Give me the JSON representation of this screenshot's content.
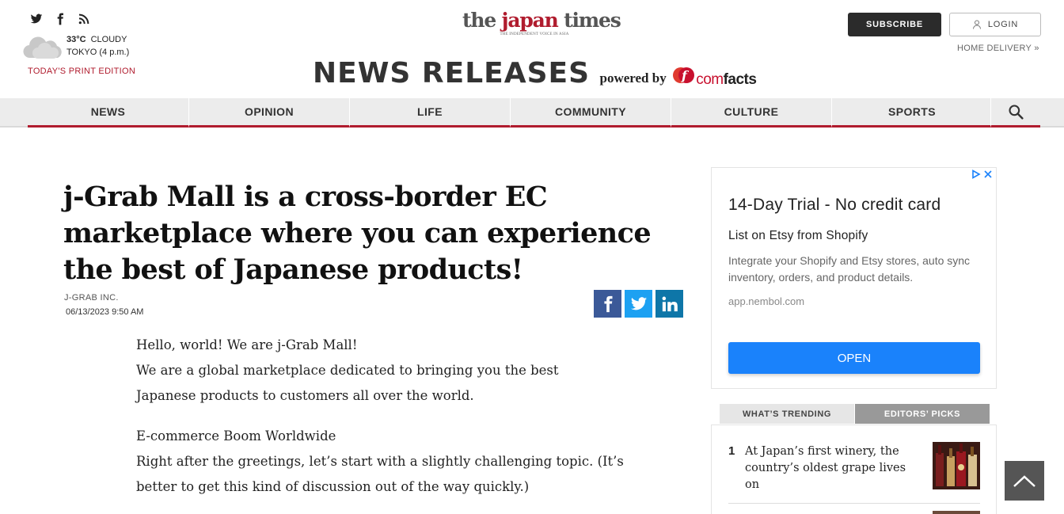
{
  "header": {
    "social_icons": [
      "twitter-icon",
      "facebook-icon",
      "rss-icon"
    ],
    "weather": {
      "temp": "33°C",
      "condition": "CLOUDY",
      "location": "TOKYO (4 p.m.)",
      "icon": "cloud-icon"
    },
    "print_edition": "TODAY'S PRINT EDITION",
    "logo": {
      "part1": "the ",
      "part2": "japan",
      "part3": " times",
      "tagline": "THE INDEPENDENT VOICE IN ASIA"
    },
    "section_title": "NEWS RELEASES",
    "powered_by": "powered by",
    "comfacts": {
      "part1": "com",
      "part2": "facts"
    },
    "subscribe": "SUBSCRIBE",
    "login": "LOGIN",
    "home_delivery": "HOME DELIVERY »"
  },
  "nav": {
    "items": [
      "NEWS",
      "OPINION",
      "LIFE",
      "COMMUNITY",
      "CULTURE",
      "SPORTS"
    ],
    "search_icon": "search-icon"
  },
  "article": {
    "headline": "j-Grab Mall is a cross-border EC marketplace where you can experience the best of Japanese products!",
    "byline": "J-GRAB INC.",
    "date": "06/13/2023 9:50 AM",
    "share": [
      "facebook-icon",
      "twitter-icon",
      "linkedin-icon"
    ],
    "paragraphs": [
      [
        "Hello, world! We are j-Grab Mall!",
        "We are a global marketplace dedicated to bringing you the best",
        "Japanese products to customers all over the world."
      ],
      [
        "E-commerce Boom Worldwide",
        "Right after the greetings, let’s start with a slightly challenging topic. (It’s",
        "better to get this kind of discussion out of the way quickly.)"
      ]
    ]
  },
  "ad": {
    "headline": "14-Day Trial - No credit card",
    "subhead": "List on Etsy from Shopify",
    "description": "Integrate your Shopify and Etsy stores, auto sync inventory, orders, and product details.",
    "url": "app.nembol.com",
    "button": "OPEN",
    "accent": "#1a82fb"
  },
  "trending": {
    "tab_active": "WHAT’S TRENDING",
    "tab_inactive": "EDITORS’ PICKS",
    "items": [
      {
        "rank": "1",
        "title": "At Japan’s first winery, the country’s oldest grape lives on"
      }
    ]
  },
  "colors": {
    "brand": "#b01c2e",
    "nav_bg": "#ececec"
  }
}
